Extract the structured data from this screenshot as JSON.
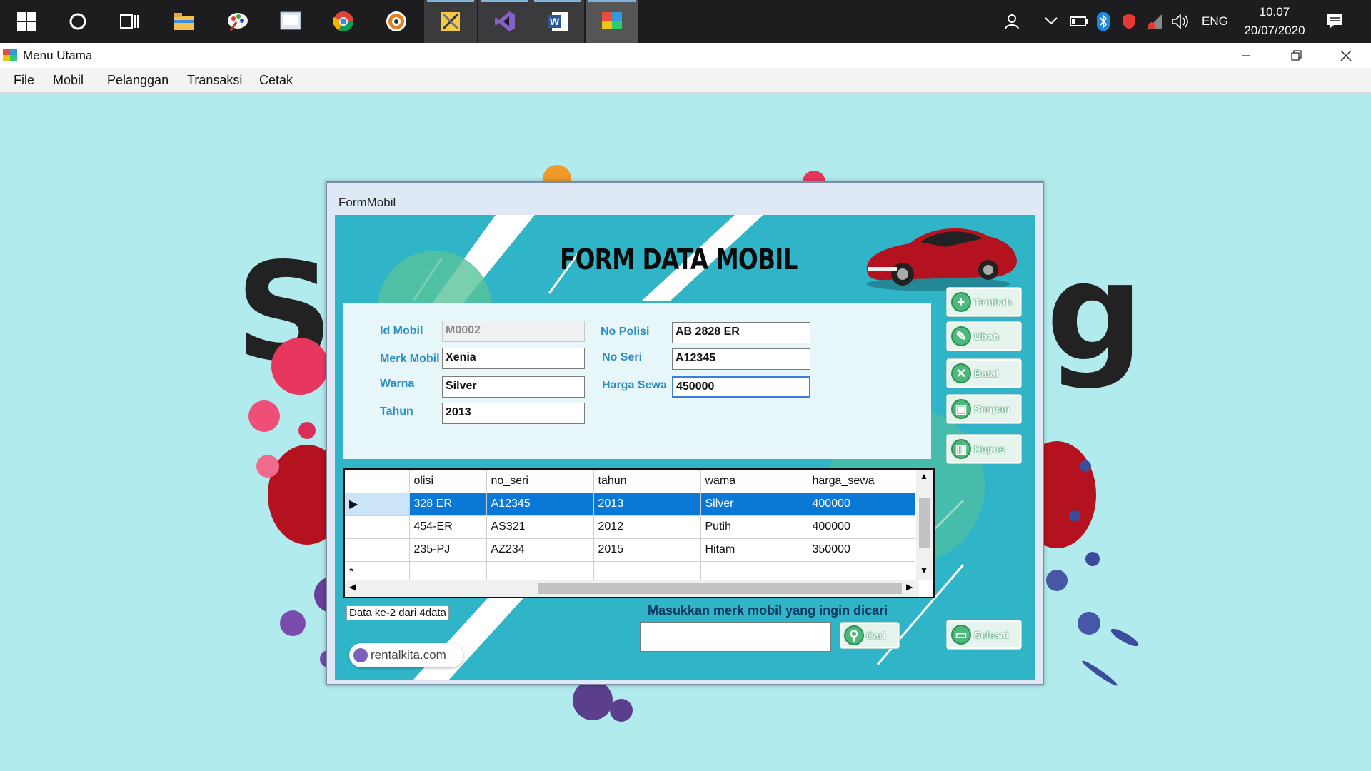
{
  "taskbar": {
    "icons": [
      "start-icon",
      "cortana-icon",
      "task-view-icon",
      "file-explorer-icon",
      "paint-icon",
      "remote-desktop-icon",
      "chrome-icon",
      "media-player-icon",
      "tools-icon",
      "visual-studio-icon",
      "word-icon",
      "app-icon"
    ],
    "language": "ENG",
    "time": "10.07",
    "date": "20/07/2020"
  },
  "window": {
    "title": "Menu Utama",
    "menu": [
      "File",
      "Mobil",
      "Pelanggan",
      "Transaksi",
      "Cetak"
    ]
  },
  "form": {
    "window_title": "FormMobil",
    "header": "FORM DATA MOBIL",
    "labels": {
      "id": "Id Mobil",
      "merk": "Merk Mobil",
      "warna": "Warna",
      "tahun": "Tahun",
      "no_polisi": "No Polisi",
      "no_seri": "No Seri",
      "harga_sewa": "Harga Sewa"
    },
    "values": {
      "id": "M0002",
      "merk": "Xenia",
      "warna": "Silver",
      "tahun": "2013",
      "no_polisi": "AB 2828 ER",
      "no_seri": "A12345",
      "harga_sewa": "450000"
    },
    "buttons": {
      "tambah": "Tambah",
      "ubah": "Ubah",
      "batal": "Batal",
      "simpan": "Simpan",
      "hapus": "Hapus",
      "selesai": "Selesai",
      "cari": "Cari"
    },
    "grid": {
      "columns": [
        "olisi",
        "no_seri",
        "tahun",
        "wama",
        "harga_sewa"
      ],
      "rows": [
        [
          "328 ER",
          "A12345",
          "2013",
          "Silver",
          "400000"
        ],
        [
          "454-ER",
          "AS321",
          "2012",
          "Putih",
          "400000"
        ],
        [
          "235-PJ",
          "AZ234",
          "2015",
          "Hitam",
          "350000"
        ]
      ],
      "selected_row": 0
    },
    "status": "Data ke-2 dari 4data",
    "search_label": "Masukkan merk mobil yang ingin dicari",
    "logo_text": "rentalkita.com"
  },
  "colors": {
    "form_bg": "#2fb5c7",
    "workspace_bg": "#b2ebed",
    "selection": "#0a78d7",
    "label": "#2b8fc6"
  }
}
